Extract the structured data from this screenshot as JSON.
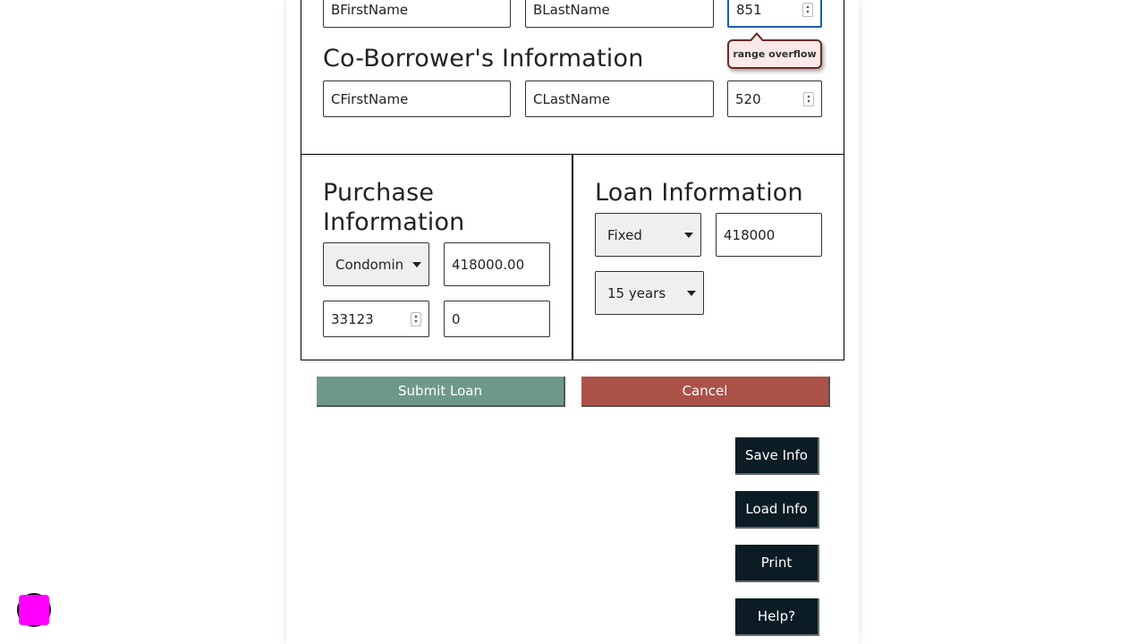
{
  "borrower": {
    "first_name": "BFirstName",
    "last_name": "BLastName",
    "credit_score": "851",
    "validation_message": "range overflow"
  },
  "co_borrower": {
    "heading": "Co-Borrower's Information",
    "first_name": "CFirstName",
    "last_name": "CLastName",
    "credit_score": "520"
  },
  "purchase": {
    "heading_line1": "Purchase",
    "heading_line2": "Information",
    "property_type": "Condomin",
    "price": "418000.00",
    "zip": "33123",
    "down_payment": "0"
  },
  "loan": {
    "heading": "Loan Information",
    "rate_type": "Fixed",
    "amount": "418000",
    "term": "15 years"
  },
  "actions": {
    "submit": "Submit Loan",
    "cancel": "Cancel",
    "save": "Save Info",
    "load": "Load Info",
    "print": "Print",
    "help": "Help?"
  },
  "colors": {
    "submit_bg": "#6e998a",
    "cancel_bg": "#ab5148",
    "dark_button_bg": "#0b1c24",
    "fab": "#ff00ff"
  }
}
